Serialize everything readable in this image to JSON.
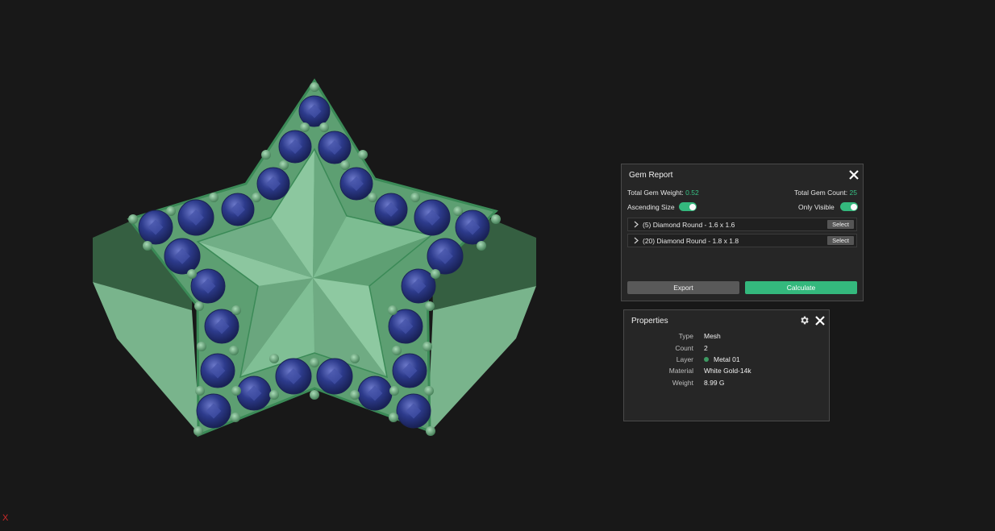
{
  "viewport": {
    "axis_label": "X",
    "metal_color": "#7fbf93",
    "gem_color": "#2c3a85",
    "background": "#181818"
  },
  "gem_report": {
    "title": "Gem Report",
    "total_weight_label": "Total Gem Weight:",
    "total_weight_value": "0.52",
    "total_count_label": "Total Gem Count:",
    "total_count_value": "25",
    "ascending_size_label": "Ascending Size",
    "only_visible_label": "Only Visible",
    "ascending_size_on": true,
    "only_visible_on": true,
    "gems": [
      {
        "label": "(5) Diamond Round - 1.6 x 1.6",
        "select_label": "Select"
      },
      {
        "label": "(20) Diamond Round - 1.8 x 1.8",
        "select_label": "Select"
      }
    ],
    "export_label": "Export",
    "calculate_label": "Calculate",
    "accent_color": "#34b87d",
    "close_icon": "close-icon"
  },
  "properties": {
    "title": "Properties",
    "gear_icon": "gear-icon",
    "close_icon": "close-icon",
    "rows": [
      {
        "key": "Type",
        "value": "Mesh"
      },
      {
        "key": "Count",
        "value": "2"
      },
      {
        "key": "Layer",
        "value": "Metal 01"
      },
      {
        "key": "Material",
        "value": "White Gold-14k"
      },
      {
        "key": "Weight",
        "value": "8.99 G"
      }
    ]
  }
}
